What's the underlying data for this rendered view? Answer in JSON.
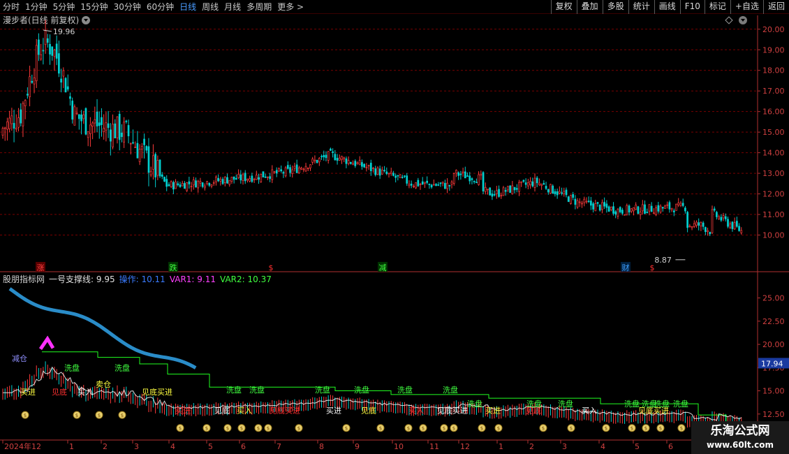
{
  "toolbar": {
    "periods": [
      "分时",
      "1分钟",
      "5分钟",
      "15分钟",
      "30分钟",
      "60分钟",
      "日线",
      "周线",
      "月线",
      "多周期",
      "更多 >"
    ],
    "active_period": "日线",
    "buttons": [
      "复权",
      "叠加",
      "多股",
      "统计",
      "画线",
      "F10",
      "标记",
      "+自选",
      "返回"
    ]
  },
  "chart_title": "漫步者(日线 前复权)",
  "main_chart": {
    "high_label": "19.96",
    "low_label": "8.87",
    "y_ticks": [
      "20.00",
      "19.00",
      "18.00",
      "17.00",
      "16.00",
      "15.00",
      "14.00",
      "13.00",
      "12.00",
      "11.00",
      "10.00"
    ],
    "markers": [
      {
        "text": "涨",
        "color": "#ff4040",
        "bg": "#5a0000"
      },
      {
        "text": "跌",
        "color": "#40ff40",
        "bg": "#003300"
      },
      {
        "text": "$",
        "color": "#ff3030",
        "bg": ""
      },
      {
        "text": "减",
        "color": "#40ff40",
        "bg": "#003300"
      },
      {
        "text": "财",
        "color": "#40a0ff",
        "bg": "#002040"
      },
      {
        "text": "$",
        "color": "#ff3030",
        "bg": ""
      }
    ]
  },
  "indicator": {
    "name": "股朋指标网",
    "line1": "一号支撑线: 9.95",
    "line2": "操作: 10.11",
    "line3": "VAR1: 9.11",
    "line4": "VAR2: 10.37",
    "y_ticks": [
      "25.00",
      "22.50",
      "20.00",
      "17.50",
      "15.00",
      "12.50"
    ],
    "current_value": "17.94",
    "labels": {
      "jiancang": "减仓",
      "maijin": "买进",
      "mairu": "买入",
      "xipan": "洗盘",
      "jiandi": "见底",
      "maihui": "卖出",
      "jiandi2": "见底买进",
      "maicang": "卖仓"
    }
  },
  "x_axis": {
    "labels": [
      "2024年12",
      "1",
      "2",
      "3",
      "4",
      "5",
      "6",
      "7",
      "8",
      "9",
      "10",
      "11",
      "12",
      "1",
      "2",
      "3",
      "4",
      "5",
      "6"
    ]
  },
  "watermark": {
    "title": "乐淘公式网",
    "url": "www.60lt.com"
  },
  "colors": {
    "up": "#ff3b3b",
    "down": "#00d0d0",
    "grid": "#7a0000",
    "axis": "#b03030",
    "ma_white": "#ffffff",
    "ma_green": "#20ff20",
    "ma_blue": "#2a8cc8",
    "ma_magenta": "#ff30ff"
  },
  "chart_data": {
    "type": "line",
    "title": "漫步者(日线 前复权)",
    "xlabel": "",
    "ylabel": "",
    "ylim": [
      8.5,
      20.5
    ],
    "x": [
      "2024-12",
      "2025-01",
      "2025-02",
      "2025-03",
      "2025-04",
      "2025-05",
      "2025-06",
      "2025-07",
      "2025-08",
      "2025-09",
      "2025-10",
      "2025-11",
      "2025-12",
      "2026-01",
      "2026-02",
      "2026-03",
      "2026-04",
      "2026-05",
      "2026-06"
    ],
    "series": [
      {
        "name": "",
        "values": [
          15.2,
          16.8,
          15.5,
          15.0,
          12.4,
          12.6,
          12.8,
          13.1,
          13.9,
          13.2,
          12.5,
          12.4,
          12.0,
          12.6,
          11.6,
          11.2,
          11.3,
          11.4,
          10.2
        ]
      }
    ],
    "high": 19.96,
    "low": 8.87
  }
}
